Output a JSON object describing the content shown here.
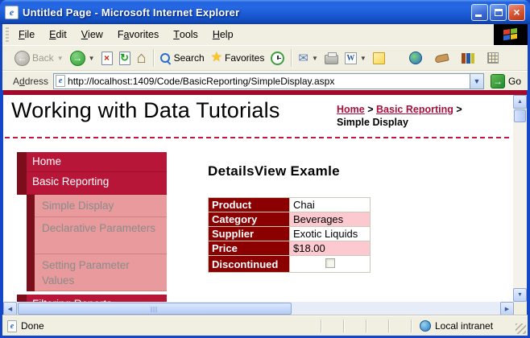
{
  "title_bar": {
    "title": "Untitled Page - Microsoft Internet Explorer"
  },
  "menu_bar": {
    "items": [
      {
        "pre": "",
        "accel": "F",
        "post": "ile"
      },
      {
        "pre": "",
        "accel": "E",
        "post": "dit"
      },
      {
        "pre": "",
        "accel": "V",
        "post": "iew"
      },
      {
        "pre": "F",
        "accel": "a",
        "post": "vorites"
      },
      {
        "pre": "",
        "accel": "T",
        "post": "ools"
      },
      {
        "pre": "",
        "accel": "H",
        "post": "elp"
      }
    ]
  },
  "toolbar": {
    "back_label": "Back",
    "search_label": "Search",
    "favorites_label": "Favorites"
  },
  "address_bar": {
    "label_pre": "A",
    "label_accel": "d",
    "label_post": "dress",
    "url": "http://localhost:1409/Code/BasicReporting/SimpleDisplay.aspx",
    "go_label": "Go"
  },
  "page": {
    "title": "Working with Data Tutorials",
    "breadcrumb": {
      "link_home": "Home",
      "sep": ">",
      "link_section": "Basic Reporting",
      "current": "Simple Display"
    },
    "sidebar": {
      "items": [
        {
          "label": "Home"
        },
        {
          "label": "Basic Reporting"
        },
        {
          "label": "Simple Display"
        },
        {
          "label": "Declarative Parameters"
        },
        {
          "label": "Setting Parameter Values"
        },
        {
          "label": "Filtering Reports"
        }
      ]
    },
    "content": {
      "heading": "DetailsView Examle",
      "details_view": {
        "rows": [
          {
            "label": "Product",
            "value": "Chai"
          },
          {
            "label": "Category",
            "value": "Beverages"
          },
          {
            "label": "Supplier",
            "value": "Exotic Liquids"
          },
          {
            "label": "Price",
            "value": "$18.00"
          },
          {
            "label": "Discontinued",
            "value": "",
            "checkbox": true,
            "checked": false
          }
        ]
      }
    }
  },
  "status_bar": {
    "status": "Done",
    "zone": "Local intranet"
  },
  "colors": {
    "title_bar_blue": "#1658D6",
    "chrome_beige": "#F1EFE2",
    "accent_bar_red": "#A00B2C",
    "menu_item_bg": "#B81638",
    "menu_strip_maroon": "#7C0D1A",
    "submenu_bg": "#E89A9C",
    "submenu_text": "#8B8B8B",
    "link_crimson": "#A6113C",
    "details_header_bg": "#8B0000",
    "details_alt_row_pink": "#FBC9CF",
    "go_button_green": "#2E9E2E"
  }
}
